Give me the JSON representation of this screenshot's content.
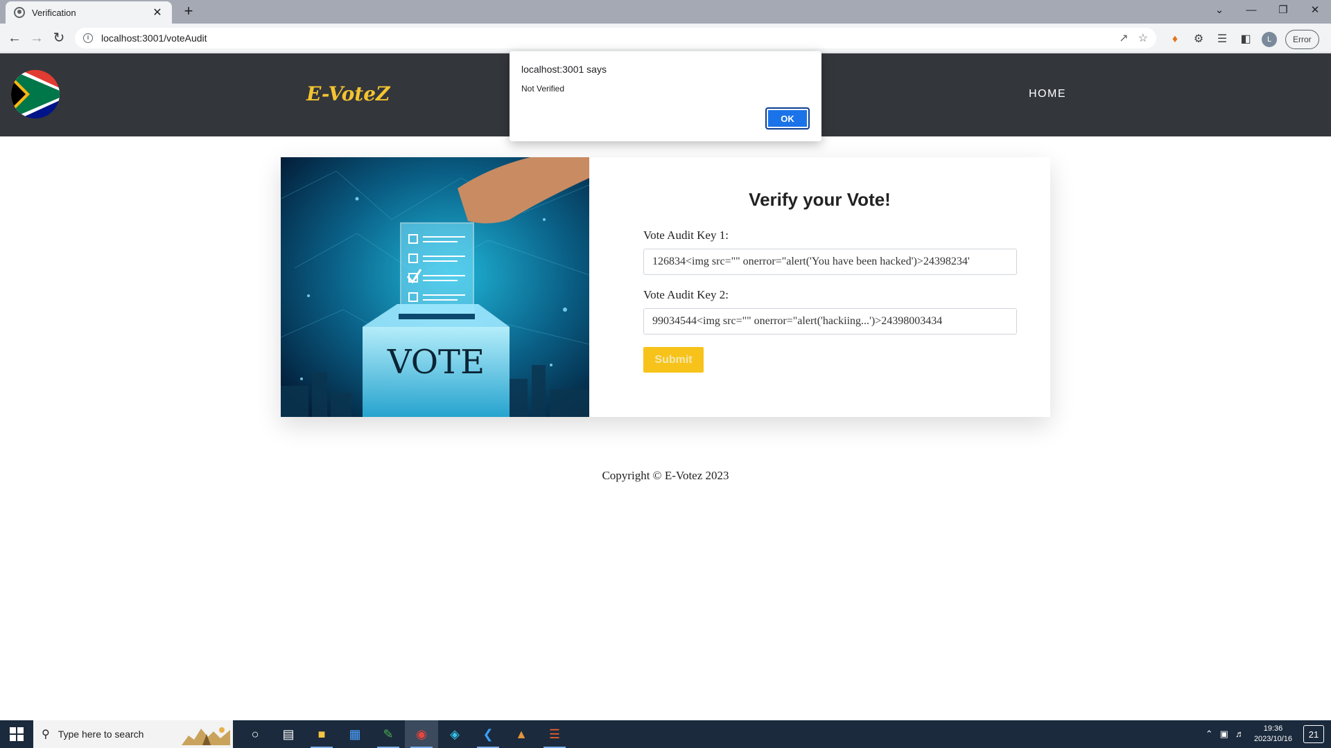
{
  "browser": {
    "tab_title": "Verification",
    "tab_close": "✕",
    "new_tab": "+",
    "url": "localhost:3001/voteAudit",
    "profile_initial": "L",
    "error_label": "Error",
    "window_controls": [
      "⌄",
      "—",
      "❐",
      "✕"
    ]
  },
  "header": {
    "brand": "E-VoteZ",
    "home_link": "HOME"
  },
  "form": {
    "title": "Verify your Vote!",
    "key1_label": "Vote Audit Key 1:",
    "key1_value": "126834<img src=\"\" onerror=\"alert('You have been hacked')>24398234'",
    "key2_label": "Vote Audit Key 2:",
    "key2_value": "99034544<img src=\"\" onerror=\"alert('hackiing...')>24398003434",
    "submit_label": "Submit"
  },
  "image": {
    "box_text": "VOTE"
  },
  "footer": {
    "copyright": "Copyright © E-Votez 2023"
  },
  "alert": {
    "title": "localhost:3001 says",
    "message": "Not Verified",
    "ok_label": "OK"
  },
  "taskbar": {
    "search_placeholder": "Type here to search",
    "time": "19:36",
    "date": "2023/10/16",
    "notification_count": "21"
  },
  "colors": {
    "header_bg": "#33363b",
    "brand": "#f4c430",
    "submit_bg": "#f7c31a",
    "alert_button": "#1a73e8"
  }
}
